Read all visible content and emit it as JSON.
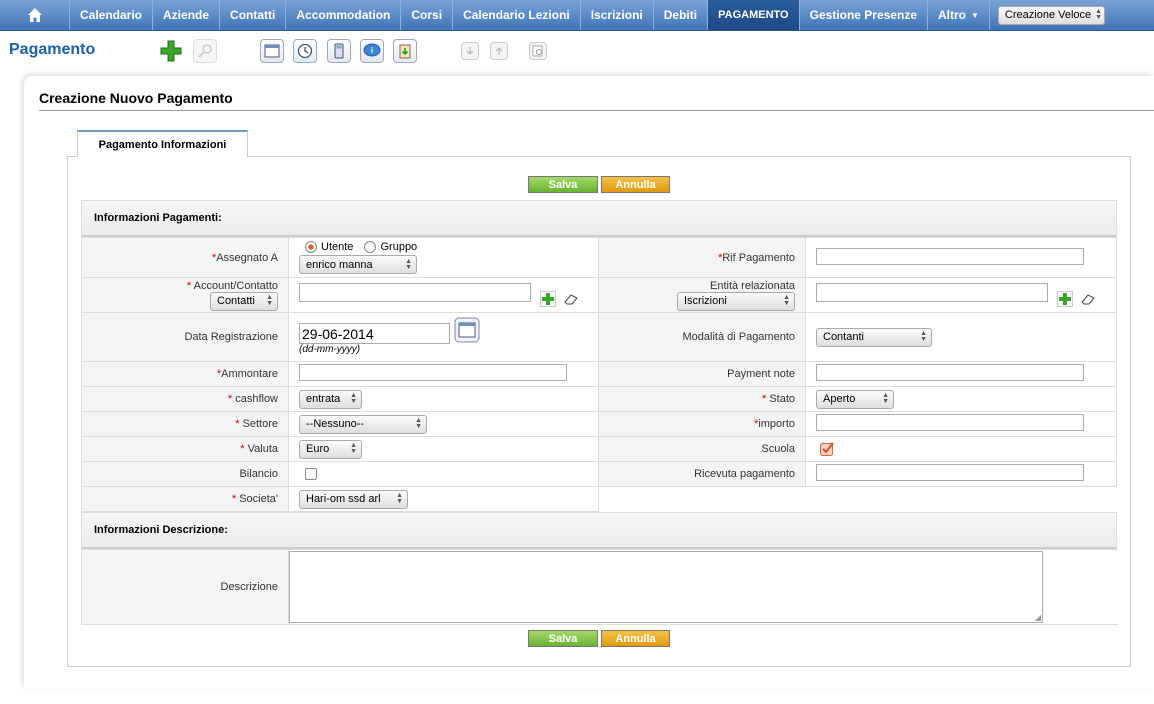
{
  "nav": {
    "tabs": [
      "Calendario",
      "Aziende",
      "Contatti",
      "Accommodation",
      "Corsi",
      "Calendario Lezioni",
      "Iscrizioni",
      "Debiti",
      "PAGAMENTO",
      "Gestione Presenze",
      "Altro"
    ],
    "active_tab": "PAGAMENTO",
    "more_label": "Altro",
    "quick_create": "Creazione Veloce"
  },
  "page": {
    "title": "Pagamento"
  },
  "panel": {
    "title": "Creazione Nuovo Pagamento",
    "tab_label": "Pagamento Informazioni",
    "save_label": "Salva",
    "cancel_label": "Annulla"
  },
  "sections": {
    "payments": "Informazioni Pagamenti:",
    "description": "Informazioni Descrizione:"
  },
  "fields": {
    "assigned_to": {
      "label": "Assegnato A",
      "radio_user": "Utente",
      "radio_group": "Gruppo",
      "value": "enrico manna"
    },
    "payment_ref": {
      "label": "Rif Pagamento",
      "value": ""
    },
    "account_contact": {
      "label": "Account/Contatto",
      "type_value": "Contatti",
      "value": ""
    },
    "related_entity": {
      "label": "Entità relazionata",
      "type_value": "Iscrizioni",
      "value": ""
    },
    "registration_date": {
      "label": "Data Registrazione",
      "value": "29-06-2014",
      "format_hint": "(dd-mm-yyyy)"
    },
    "payment_mode": {
      "label": "Modalità di Pagamento",
      "value": "Contanti"
    },
    "amount": {
      "label": "Ammontare",
      "value": ""
    },
    "payment_note": {
      "label": "Payment note",
      "value": ""
    },
    "cashflow": {
      "label": "cashflow",
      "value": "entrata"
    },
    "status": {
      "label": "Stato",
      "value": "Aperto"
    },
    "sector": {
      "label": "Settore",
      "value": "--Nessuno--"
    },
    "importo": {
      "label": "importo",
      "value": ""
    },
    "currency": {
      "label": "Valuta",
      "value": "Euro"
    },
    "school": {
      "label": "Scuola",
      "checked": true
    },
    "balance": {
      "label": "Bilancio",
      "checked": false
    },
    "receipt": {
      "label": "Ricevuta pagamento",
      "value": ""
    },
    "company": {
      "label": "Societa'",
      "value": "Hari-om ssd arl"
    },
    "description": {
      "label": "Descrizione",
      "value": ""
    }
  },
  "colors": {
    "nav_bg": "#4f82c4",
    "title_blue": "#1d5fa8",
    "save_green": "#7cc043",
    "cancel_orange": "#eaa820",
    "required_red": "#cc0000"
  }
}
